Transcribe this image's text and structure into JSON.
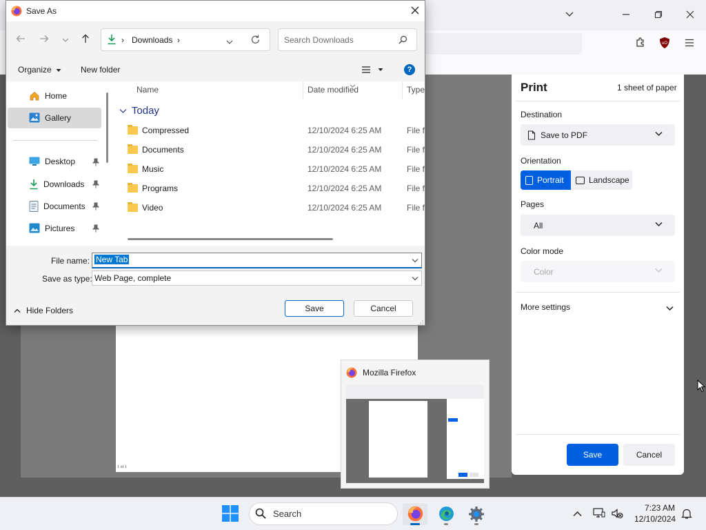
{
  "dialog": {
    "title": "Save As",
    "address": {
      "segment": "Downloads",
      "sep": "›"
    },
    "search_placeholder": "Search Downloads",
    "toolbar": {
      "organize": "Organize",
      "new_folder": "New folder",
      "help": "?"
    },
    "tree": [
      {
        "label": "Home",
        "icon": "home-icon"
      },
      {
        "label": "Gallery",
        "icon": "gallery-icon",
        "selected": true
      },
      {
        "label": "Desktop",
        "icon": "desktop-icon",
        "pinned": true
      },
      {
        "label": "Downloads",
        "icon": "download-icon",
        "pinned": true
      },
      {
        "label": "Documents",
        "icon": "documents-icon",
        "pinned": true
      },
      {
        "label": "Pictures",
        "icon": "pictures-icon",
        "pinned": true
      }
    ],
    "columns": {
      "name": "Name",
      "date": "Date modified",
      "type": "Type"
    },
    "group": "Today",
    "files": [
      {
        "name": "Compressed",
        "date": "12/10/2024 6:25 AM",
        "type": "File fo"
      },
      {
        "name": "Documents",
        "date": "12/10/2024 6:25 AM",
        "type": "File fo"
      },
      {
        "name": "Music",
        "date": "12/10/2024 6:25 AM",
        "type": "File fo"
      },
      {
        "name": "Programs",
        "date": "12/10/2024 6:25 AM",
        "type": "File fo"
      },
      {
        "name": "Video",
        "date": "12/10/2024 6:25 AM",
        "type": "File fo"
      }
    ],
    "file_name_label": "File name:",
    "file_name_value": "New Tab",
    "save_type_label": "Save as type:",
    "save_type_value": "Web Page, complete",
    "hide_folders": "Hide Folders",
    "save_button": "Save",
    "cancel_button": "Cancel"
  },
  "print_panel": {
    "title": "Print",
    "sheet_count": "1 sheet of paper",
    "destination_label": "Destination",
    "destination_value": "Save to PDF",
    "orientation_label": "Orientation",
    "portrait": "Portrait",
    "landscape": "Landscape",
    "pages_label": "Pages",
    "pages_value": "All",
    "color_mode_label": "Color mode",
    "color_mode_value": "Color",
    "more_settings": "More settings",
    "save_button": "Save",
    "cancel_button": "Cancel"
  },
  "preview": {
    "page_count": "1 of 1"
  },
  "thumbnail": {
    "title": "Mozilla Firefox"
  },
  "taskbar": {
    "search_label": "Search",
    "time": "7:23 AM",
    "date": "12/10/2024"
  },
  "colors": {
    "accent": "#0060df",
    "win_accent": "#0067c0",
    "folder": "#f8c94e"
  }
}
